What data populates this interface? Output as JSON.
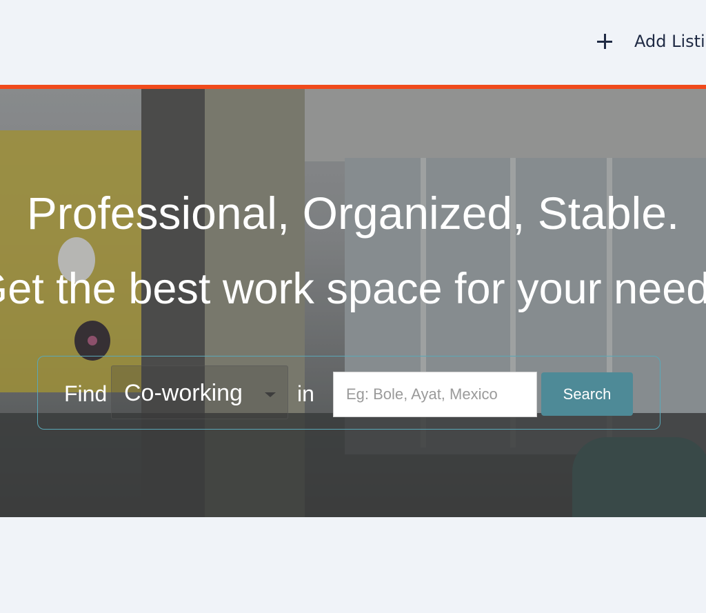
{
  "header": {
    "add_listing_label": "Add Listing",
    "plus_icon": "plus-icon"
  },
  "colors": {
    "accent_line": "#f04a1c",
    "search_button": "#4e8a97",
    "search_box_border": "#5aa8b8"
  },
  "hero": {
    "headline": "Professional, Organized, Stable.",
    "subline": "Get the best work space for your needs",
    "search": {
      "find_label": "Find",
      "type_selected": "Co-working",
      "in_label": "in",
      "location_placeholder": "Eg: Bole, Ayat, Mexico",
      "location_value": "",
      "button_label": "Search",
      "caret_icon": "caret-down-icon"
    }
  }
}
